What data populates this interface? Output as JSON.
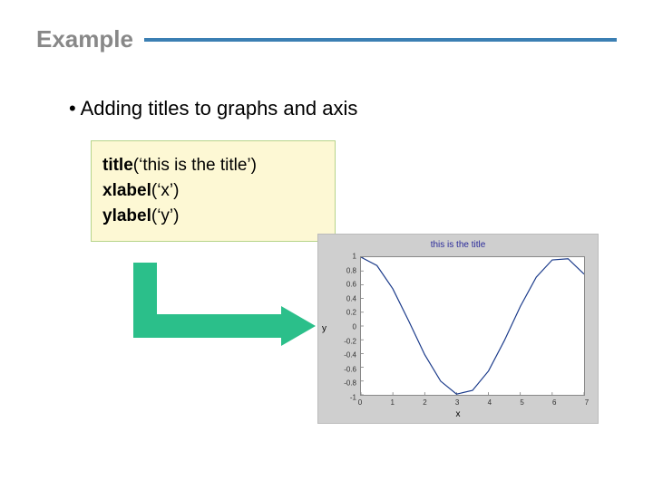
{
  "header": {
    "title": "Example"
  },
  "bullet": {
    "text": "Adding titles to graphs and axis"
  },
  "code": {
    "line1_bold": "title",
    "line1_rest": "(‘this is the title’)",
    "line2_bold": "xlabel",
    "line2_rest": "(‘x’)",
    "line3_bold": "ylabel",
    "line3_rest": "(‘y’)"
  },
  "chart_data": {
    "type": "line",
    "title": "this is the title",
    "xlabel": "x",
    "ylabel": "y",
    "xlim": [
      0,
      7
    ],
    "ylim": [
      -1,
      1
    ],
    "xticks": [
      0,
      1,
      2,
      3,
      4,
      5,
      6,
      7
    ],
    "yticks": [
      -1,
      -0.8,
      -0.6,
      -0.4,
      -0.2,
      0,
      0.2,
      0.4,
      0.6,
      0.8,
      1
    ],
    "x": [
      0,
      0.5,
      1,
      1.5,
      2,
      2.5,
      3,
      3.5,
      4,
      4.5,
      5,
      5.5,
      6,
      6.5,
      7
    ],
    "y": [
      1,
      0.878,
      0.54,
      0.071,
      -0.416,
      -0.801,
      -0.99,
      -0.936,
      -0.654,
      -0.211,
      0.284,
      0.709,
      0.96,
      0.977,
      0.754
    ]
  }
}
